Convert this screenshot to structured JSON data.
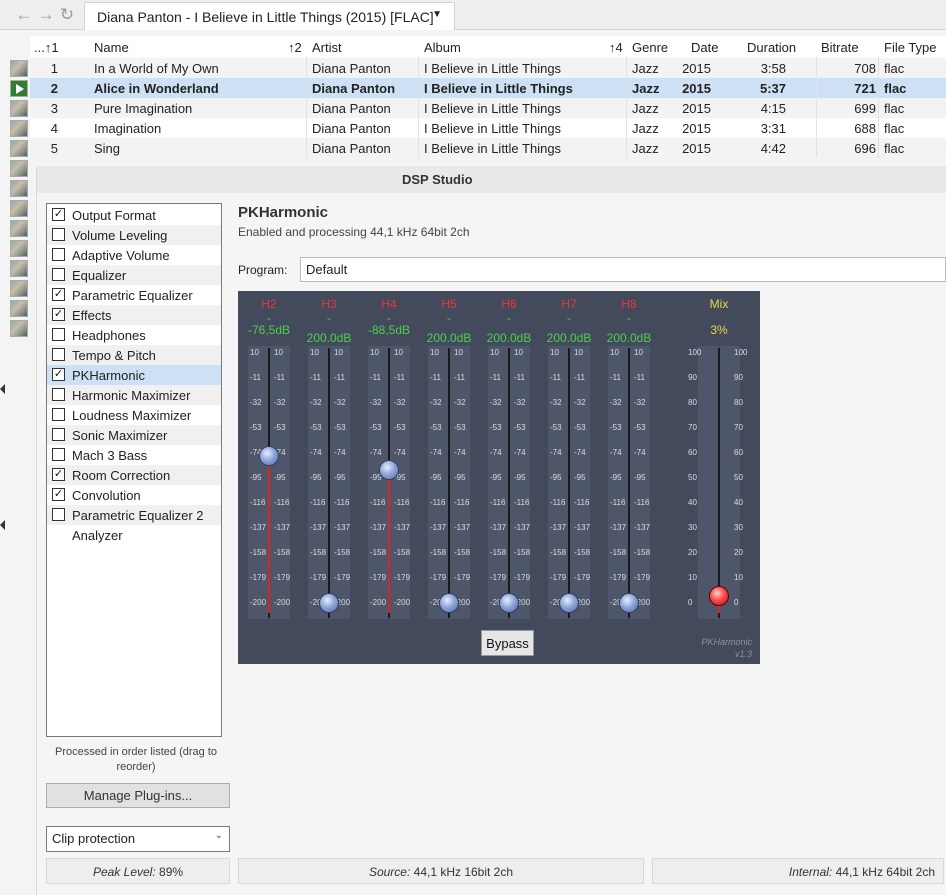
{
  "topbar": {
    "back_icon": "arrow-left-icon",
    "forward_icon": "arrow-right-icon",
    "refresh_icon": "refresh-icon",
    "view_title": "Diana Panton - I Believe in Little Things (2015) [FLAC]"
  },
  "tracklist": {
    "headers": {
      "num": "...↑1",
      "name": "Name",
      "artist_sort": "↑2",
      "artist": "Artist",
      "album": "Album",
      "album_sort": "↑4",
      "genre": "Genre",
      "date": "Date",
      "duration": "Duration",
      "bitrate": "Bitrate",
      "filetype": "File Type"
    },
    "rows": [
      {
        "num": "1",
        "name": "In a World of My Own",
        "artist": "Diana Panton",
        "album": "I Believe in Little Things",
        "genre": "Jazz",
        "date": "2015",
        "duration": "3:58",
        "bitrate": "708",
        "filetype": "flac"
      },
      {
        "num": "2",
        "name": "Alice in Wonderland",
        "artist": "Diana Panton",
        "album": "I Believe in Little Things",
        "genre": "Jazz",
        "date": "2015",
        "duration": "5:37",
        "bitrate": "721",
        "filetype": "flac"
      },
      {
        "num": "3",
        "name": "Pure Imagination",
        "artist": "Diana Panton",
        "album": "I Believe in Little Things",
        "genre": "Jazz",
        "date": "2015",
        "duration": "4:15",
        "bitrate": "699",
        "filetype": "flac"
      },
      {
        "num": "4",
        "name": "Imagination",
        "artist": "Diana Panton",
        "album": "I Believe in Little Things",
        "genre": "Jazz",
        "date": "2015",
        "duration": "3:31",
        "bitrate": "688",
        "filetype": "flac"
      },
      {
        "num": "5",
        "name": "Sing",
        "artist": "Diana Panton",
        "album": "I Believe in Little Things",
        "genre": "Jazz",
        "date": "2015",
        "duration": "4:42",
        "bitrate": "696",
        "filetype": "flac"
      }
    ]
  },
  "dsp": {
    "title": "DSP Studio",
    "plugins": [
      {
        "label": "Output Format",
        "checked": true
      },
      {
        "label": "Volume Leveling",
        "checked": false
      },
      {
        "label": "Adaptive Volume",
        "checked": false
      },
      {
        "label": "Equalizer",
        "checked": false
      },
      {
        "label": "Parametric Equalizer",
        "checked": true
      },
      {
        "label": "Effects",
        "checked": true
      },
      {
        "label": "Headphones",
        "checked": false
      },
      {
        "label": "Tempo & Pitch",
        "checked": false
      },
      {
        "label": "PKHarmonic",
        "checked": true
      },
      {
        "label": "Harmonic Maximizer",
        "checked": false
      },
      {
        "label": "Loudness Maximizer",
        "checked": false
      },
      {
        "label": "Sonic Maximizer",
        "checked": false
      },
      {
        "label": "Mach 3 Bass",
        "checked": false
      },
      {
        "label": "Room Correction",
        "checked": true
      },
      {
        "label": "Convolution",
        "checked": true
      },
      {
        "label": "Parametric Equalizer 2",
        "checked": false
      },
      {
        "label": "Analyzer",
        "checked": null
      }
    ],
    "hint": "Processed in order listed (drag to reorder)",
    "manage_label": "Manage Plug-ins...",
    "clip_value": "Clip protection",
    "plugin_title": "PKHarmonic",
    "plugin_status": "Enabled and processing 44,1 kHz 64bit 2ch",
    "program_label": "Program:",
    "program_value": "Default",
    "harmonics": [
      {
        "name": "H2",
        "value_label": "-76,5dB",
        "level_db": -76.5
      },
      {
        "name": "H3",
        "value_label": "200.0dB",
        "level_db": -200
      },
      {
        "name": "H4",
        "value_label": "-88,5dB",
        "level_db": -88.5
      },
      {
        "name": "H5",
        "value_label": "200.0dB",
        "level_db": -200
      },
      {
        "name": "H6",
        "value_label": "200.0dB",
        "level_db": -200
      },
      {
        "name": "H7",
        "value_label": "200.0dB",
        "level_db": -200
      },
      {
        "name": "H8",
        "value_label": "200.0dB",
        "level_db": -200
      }
    ],
    "db_ticks": [
      "10",
      "-11",
      "-32",
      "-53",
      "-74",
      "-95",
      "-116",
      "-137",
      "-158",
      "-179",
      "-200"
    ],
    "mix": {
      "name": "Mix",
      "value_label": "3%",
      "percent": 3
    },
    "mix_ticks": [
      "100",
      "90",
      "80",
      "70",
      "60",
      "50",
      "40",
      "30",
      "20",
      "10",
      "0"
    ],
    "bypass_label": "Bypass",
    "brand_name": "PKHarmonic",
    "brand_version": "v1.3",
    "status": {
      "peak_label": "Peak Level:",
      "peak_value": "89%",
      "source_label": "Source:",
      "source_value": "44,1 kHz 16bit 2ch",
      "internal_label": "Internal:",
      "internal_value": "44,1 kHz 64bit 2ch"
    }
  },
  "colors": {
    "selection": "#cde0f4",
    "panel_bg": "#424a5c",
    "harmonic_name": "#e23a3a",
    "value_green": "#4ed04e",
    "mix_yellow": "#e8d94a"
  }
}
